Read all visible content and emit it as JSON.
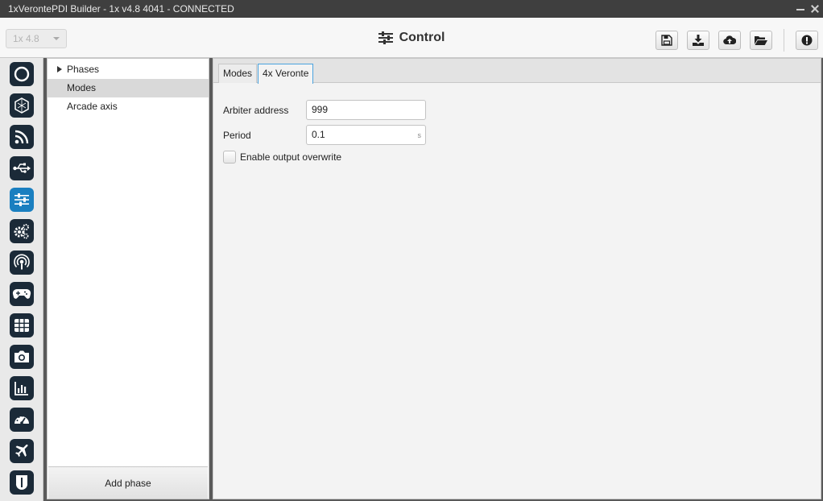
{
  "window": {
    "title": "1xVerontePDI Builder - 1x v4.8 4041 - CONNECTED"
  },
  "header": {
    "version_select": "1x 4.8",
    "title": "Control",
    "toolbar": [
      "save-icon",
      "download-icon",
      "cloud-upload-icon",
      "folder-open-icon",
      "alert-icon"
    ]
  },
  "rail": {
    "items": [
      "ring-icon",
      "hexagon-icon",
      "rss-icon",
      "usb-icon",
      "sliders-icon",
      "gears-icon",
      "broadcast-icon",
      "gamepad-icon",
      "grid-icon",
      "camera-icon",
      "bar-chart-icon",
      "gauge-icon",
      "airplane-icon",
      "shield-icon"
    ],
    "active": "sliders-icon"
  },
  "tree": {
    "items": [
      {
        "label": "Phases",
        "expandable": true
      },
      {
        "label": "Modes",
        "selected": true
      },
      {
        "label": "Arcade axis"
      }
    ],
    "add_phase": "Add phase"
  },
  "tabs": [
    {
      "label": "Modes",
      "active": false
    },
    {
      "label": "4x Veronte",
      "active": true
    }
  ],
  "form": {
    "arbiter_label": "Arbiter address",
    "arbiter_value": "999",
    "period_label": "Period",
    "period_value": "0.1",
    "period_unit": "s",
    "overwrite_label": "Enable output overwrite",
    "overwrite_checked": false
  },
  "colors": {
    "accent": "#1a7fc0",
    "rail_icon_bg": "#1b2a38",
    "titlebar": "#3f3f3f"
  }
}
